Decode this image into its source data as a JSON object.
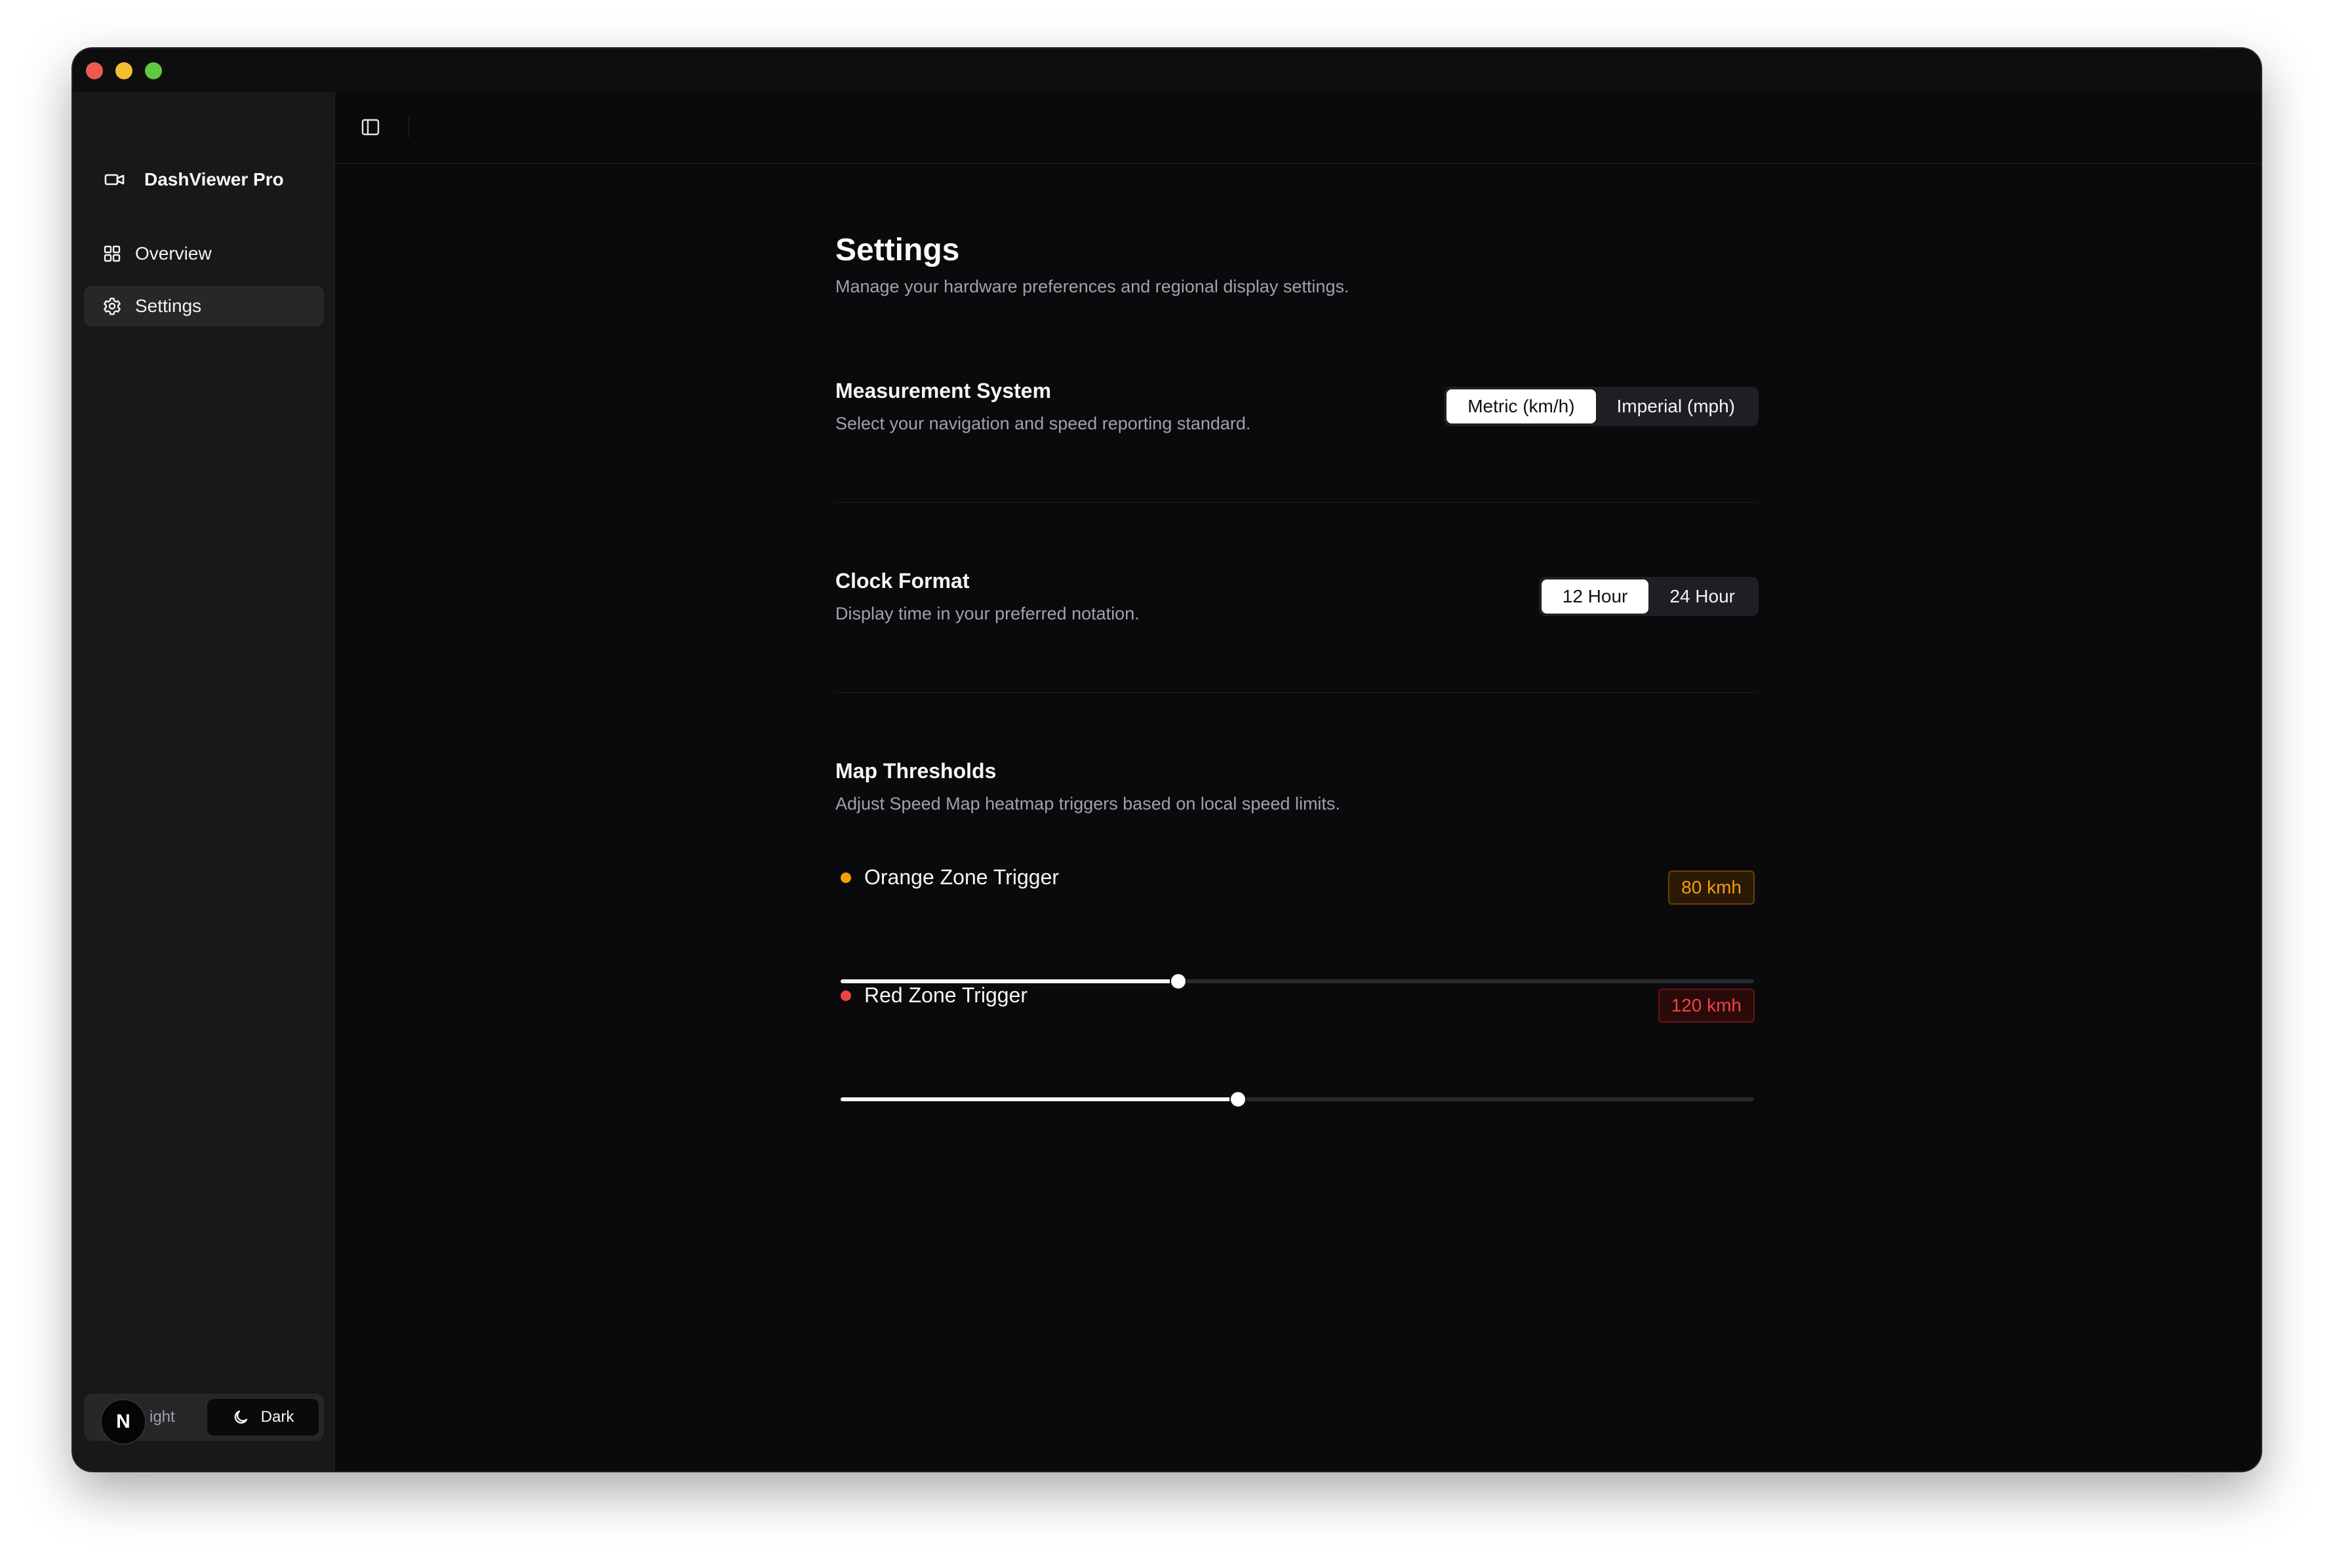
{
  "app": {
    "name": "DashViewer Pro"
  },
  "sidebar": {
    "items": [
      {
        "label": "Overview",
        "icon": "grid-icon",
        "active": false
      },
      {
        "label": "Settings",
        "icon": "gear-icon",
        "active": true
      }
    ],
    "theme": {
      "light_label": "ight",
      "dark_label": "Dark",
      "selected": "Dark"
    },
    "avatar_initial": "N"
  },
  "page": {
    "title": "Settings",
    "subtitle": "Manage your hardware preferences and regional display settings."
  },
  "measurement": {
    "title": "Measurement System",
    "description": "Select your navigation and speed reporting standard.",
    "options": [
      "Metric (km/h)",
      "Imperial (mph)"
    ],
    "selected": "Metric (km/h)"
  },
  "clock": {
    "title": "Clock Format",
    "description": "Display time in your preferred notation.",
    "options": [
      "12 Hour",
      "24 Hour"
    ],
    "selected": "12 Hour"
  },
  "thresholds": {
    "title": "Map Thresholds",
    "description": "Adjust Speed Map heatmap triggers based on local speed limits.",
    "items": [
      {
        "label": "Orange Zone Trigger",
        "value_text": "80 kmh",
        "fill_fraction": 0.37,
        "color": "#f59e0b"
      },
      {
        "label": "Red Zone Trigger",
        "value_text": "120 kmh",
        "fill_fraction": 0.435,
        "color": "#ef4444"
      }
    ]
  }
}
